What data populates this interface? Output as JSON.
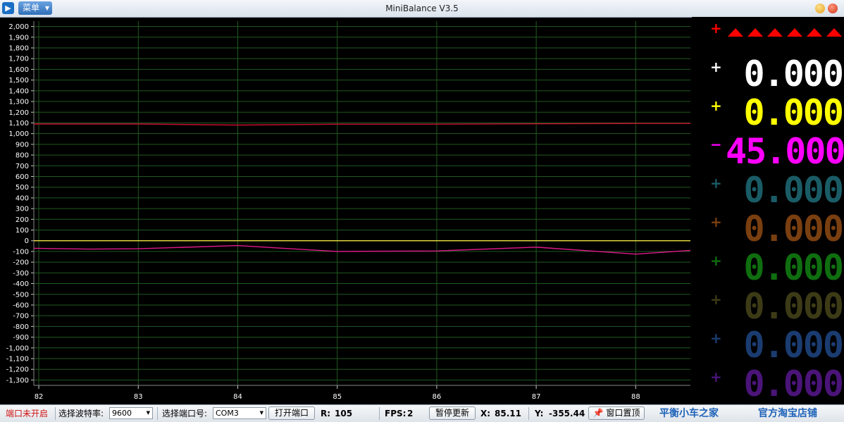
{
  "window": {
    "title": "MiniBalance V3.5",
    "menu_label": "菜单"
  },
  "chart_data": {
    "type": "line",
    "xlim": [
      81.95,
      88.55
    ],
    "ylim": [
      -1350,
      2050
    ],
    "x_ticks": [
      "82",
      "83",
      "84",
      "85",
      "86",
      "87",
      "88"
    ],
    "y_ticks": [
      "2,000",
      "1,900",
      "1,800",
      "1,700",
      "1,600",
      "1,500",
      "1,400",
      "1,300",
      "1,200",
      "1,100",
      "1,000",
      "900",
      "800",
      "700",
      "600",
      "500",
      "400",
      "300",
      "200",
      "100",
      "0",
      "-100",
      "-200",
      "-300",
      "-400",
      "-500",
      "-600",
      "-700",
      "-800",
      "-900",
      "-1,000",
      "-1,100",
      "-1,200",
      "-1,300"
    ],
    "grid": true,
    "series": [
      {
        "color": "#c8102e",
        "x": [
          81.95,
          82.5,
          83.0,
          84.0,
          85.0,
          86.0,
          87.0,
          88.0,
          88.55
        ],
        "y": [
          1090,
          1090,
          1090,
          1080,
          1088,
          1088,
          1092,
          1095,
          1095
        ]
      },
      {
        "color": "#f0e040",
        "x": [
          81.95,
          88.55
        ],
        "y": [
          0,
          0
        ]
      },
      {
        "color": "#e0188c",
        "x": [
          81.95,
          82.5,
          83.0,
          84.0,
          85.0,
          86.0,
          87.0,
          88.0,
          88.55
        ],
        "y": [
          -70,
          -78,
          -75,
          -45,
          -100,
          -95,
          -60,
          -125,
          -90
        ]
      }
    ]
  },
  "side_panel": {
    "alarm_color": "#ff0000",
    "channels": [
      {
        "sign": "+",
        "value": "",
        "color": "#ff0000"
      },
      {
        "sign": "+",
        "value": "0.000",
        "color": "#ffffff"
      },
      {
        "sign": "+",
        "value": "0.000",
        "color": "#ffff00"
      },
      {
        "sign": "−",
        "value": "45.000",
        "color": "#ff00ff"
      },
      {
        "sign": "+",
        "value": "0.000",
        "color": "#1a5c66"
      },
      {
        "sign": "+",
        "value": "0.000",
        "color": "#7a3f10"
      },
      {
        "sign": "+",
        "value": "0.000",
        "color": "#0f6e0f"
      },
      {
        "sign": "+",
        "value": "0.000",
        "color": "#3d3b16"
      },
      {
        "sign": "+",
        "value": "0.000",
        "color": "#1a3c70"
      },
      {
        "sign": "+",
        "value": "0.000",
        "color": "#4a1478"
      }
    ]
  },
  "status": {
    "port_status": "端口未开启",
    "baud_label": "选择波特率:",
    "baud_value": "9600",
    "port_label": "选择端口号:",
    "port_value": "COM3",
    "open_port_button": "打开端口",
    "r_label": "R:",
    "r_value": "105",
    "fps_label": "FPS:",
    "fps_value": "2",
    "pause_button": "暂停更新",
    "x_label": "X:",
    "x_value": "85.11",
    "y_label": "Y:",
    "y_value": "-355.44",
    "pin_button": "窗口置顶",
    "link_home": "平衡小车之家",
    "link_shop": "官方淘宝店铺"
  }
}
